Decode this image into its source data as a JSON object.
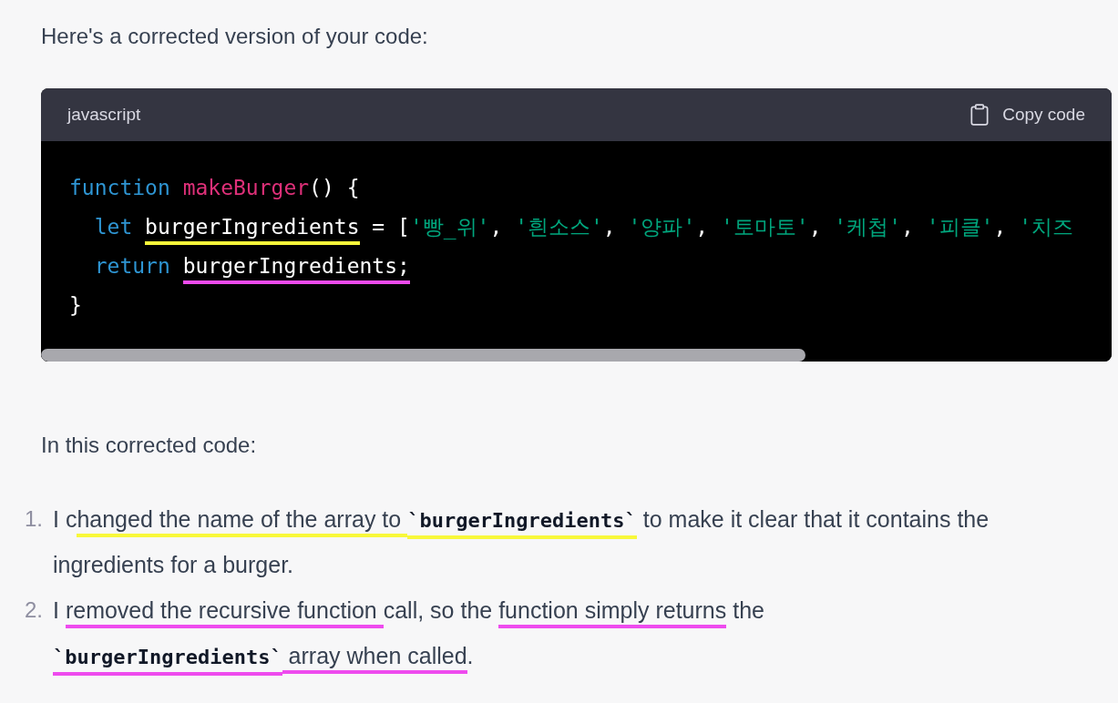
{
  "intro": "Here's a corrected version of your code:",
  "code_block": {
    "language": "javascript",
    "copy_label": "Copy code",
    "lines": [
      [
        {
          "kind": "keyword",
          "text": "function "
        },
        {
          "kind": "function",
          "text": "makeBurger"
        },
        {
          "kind": "plain",
          "text": "() {"
        }
      ],
      [
        {
          "kind": "keyword",
          "text": "  let "
        },
        {
          "kind": "plain",
          "text": "burgerIngredients",
          "color": "#f8f83a"
        },
        {
          "kind": "plain",
          "text": " = ["
        },
        {
          "kind": "string",
          "text": "'빵_위'"
        },
        {
          "kind": "plain",
          "text": ", "
        },
        {
          "kind": "string",
          "text": "'흰소스'"
        },
        {
          "kind": "plain",
          "text": ", "
        },
        {
          "kind": "string",
          "text": "'양파'"
        },
        {
          "kind": "plain",
          "text": ", "
        },
        {
          "kind": "string",
          "text": "'토마토'"
        },
        {
          "kind": "plain",
          "text": ", "
        },
        {
          "kind": "string",
          "text": "'케첩'"
        },
        {
          "kind": "plain",
          "text": ", "
        },
        {
          "kind": "string",
          "text": "'피클'"
        },
        {
          "kind": "plain",
          "text": ", "
        },
        {
          "kind": "string",
          "text": "'치즈"
        }
      ],
      [
        {
          "kind": "keyword",
          "text": "  return "
        },
        {
          "kind": "plain",
          "text": "burgerIngredients;",
          "color": "#ee4bee"
        }
      ],
      [
        {
          "kind": "plain",
          "text": "}"
        }
      ]
    ]
  },
  "summary": "In this corrected code:",
  "list": {
    "items": [
      {
        "number": "1.",
        "segments": [
          {
            "kind": "text",
            "text": "I c"
          },
          {
            "kind": "text",
            "text": "hanged the name of the array to ",
            "color": "#f8f83a"
          },
          {
            "kind": "code",
            "text": "`burgerIngredients`",
            "color": "#f8f83a"
          },
          {
            "kind": "text",
            "text": " to make it clear that it contains the ingredients for a burger."
          }
        ]
      },
      {
        "number": "2.",
        "segments": [
          {
            "kind": "text",
            "text": "I "
          },
          {
            "kind": "text",
            "text": "removed the recursive function ",
            "color": "#ee4bee"
          },
          {
            "kind": "text",
            "text": "call, so the "
          },
          {
            "kind": "text",
            "text": "function simply returns",
            "color": "#ee4bee"
          },
          {
            "kind": "text",
            "text": " the "
          },
          {
            "kind": "code",
            "text": "`burgerIngredients`",
            "color": "#ee4bee"
          },
          {
            "kind": "text",
            "text": " array when called",
            "color": "#ee4bee"
          },
          {
            "kind": "text",
            "text": "."
          }
        ]
      }
    ]
  }
}
